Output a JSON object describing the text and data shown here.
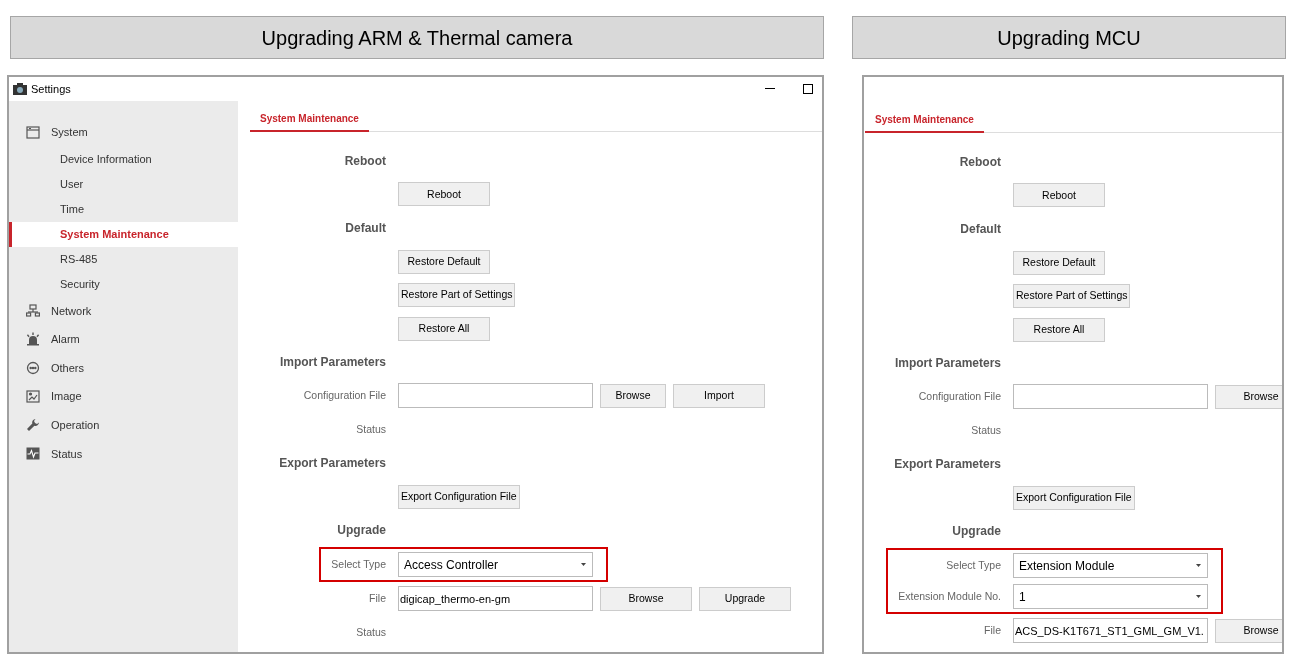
{
  "panels": [
    {
      "heading": "Upgrading ARM & Thermal camera",
      "window": {
        "title": "Settings",
        "sidebar": [
          {
            "label": "System",
            "children": [
              {
                "label": "Device Information",
                "selected": false
              },
              {
                "label": "User",
                "selected": false
              },
              {
                "label": "Time",
                "selected": false
              },
              {
                "label": "System Maintenance",
                "selected": true
              },
              {
                "label": "RS-485",
                "selected": false
              },
              {
                "label": "Security",
                "selected": false
              }
            ]
          },
          {
            "label": "Network"
          },
          {
            "label": "Alarm"
          },
          {
            "label": "Others"
          },
          {
            "label": "Image"
          },
          {
            "label": "Operation"
          },
          {
            "label": "Status"
          }
        ],
        "tab": "System Maintenance",
        "sections": [
          {
            "title": "Reboot",
            "rows": [
              {
                "kind": "buttons",
                "buttons": [
                  "Reboot"
                ]
              }
            ]
          },
          {
            "title": "Default",
            "rows": [
              {
                "kind": "buttons",
                "buttons": [
                  "Restore Default"
                ]
              },
              {
                "kind": "buttons",
                "buttons": [
                  "Restore Part of Settings"
                ]
              },
              {
                "kind": "buttons",
                "buttons": [
                  "Restore All"
                ]
              }
            ]
          },
          {
            "title": "Import Parameters",
            "rows": [
              {
                "kind": "field",
                "label": "Configuration File",
                "buttons": [
                  "Browse",
                  "Import"
                ]
              },
              {
                "kind": "status",
                "label": "Status"
              }
            ]
          },
          {
            "title": "Export Parameters",
            "rows": [
              {
                "kind": "buttons",
                "buttons": [
                  "Export Configuration File"
                ]
              }
            ]
          },
          {
            "title": "Upgrade",
            "rows": [
              {
                "kind": "select",
                "label": "Select Type",
                "value": "Access Controller",
                "highlighted": true
              },
              {
                "kind": "field",
                "label": "File",
                "value": "digicap_thermo-en-gm",
                "buttons": [
                  "Browse",
                  "Upgrade"
                ]
              },
              {
                "kind": "status",
                "label": "Status"
              }
            ]
          }
        ]
      }
    },
    {
      "heading": "Upgrading MCU",
      "window": {
        "tab": "System Maintenance",
        "sections": [
          {
            "title": "Reboot",
            "rows": [
              {
                "kind": "buttons",
                "buttons": [
                  "Reboot"
                ]
              }
            ]
          },
          {
            "title": "Default",
            "rows": [
              {
                "kind": "buttons",
                "buttons": [
                  "Restore Default"
                ]
              },
              {
                "kind": "buttons",
                "buttons": [
                  "Restore Part of Settings"
                ]
              },
              {
                "kind": "buttons",
                "buttons": [
                  "Restore All"
                ]
              }
            ]
          },
          {
            "title": "Import Parameters",
            "rows": [
              {
                "kind": "field",
                "label": "Configuration File",
                "buttons": [
                  "Browse"
                ]
              },
              {
                "kind": "status",
                "label": "Status"
              }
            ]
          },
          {
            "title": "Export Parameters",
            "rows": [
              {
                "kind": "buttons",
                "buttons": [
                  "Export Configuration File"
                ]
              }
            ]
          },
          {
            "title": "Upgrade",
            "rows": [
              {
                "kind": "select",
                "label": "Select Type",
                "value": "Extension Module",
                "highlighted": true
              },
              {
                "kind": "select",
                "label": "Extension Module No.",
                "value": "1",
                "highlighted": true
              },
              {
                "kind": "field",
                "label": "File",
                "value": "ACS_DS-K1T671_ST1_GML_GM_V1.",
                "buttons": [
                  "Browse"
                ]
              }
            ]
          }
        ]
      }
    }
  ]
}
